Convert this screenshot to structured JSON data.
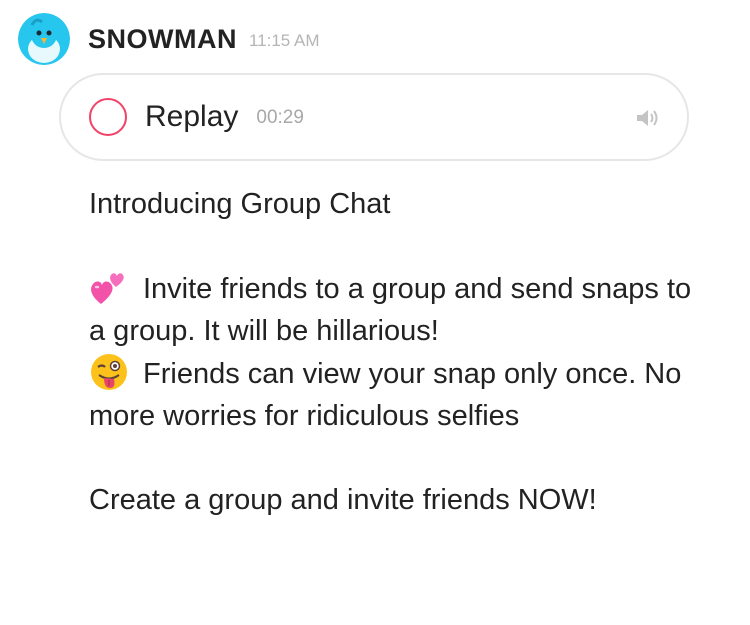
{
  "message": {
    "sender": "SNOWMAN",
    "time": "11:15 AM",
    "avatar_icon": "bird-icon",
    "replay": {
      "label": "Replay",
      "duration": "00:29",
      "speaker_icon": "speaker-icon",
      "accent": "#f2426a"
    },
    "body": {
      "title": "Introducing Group Chat",
      "para1_icon": "two-hearts-emoji",
      "para1_text": "Invite friends to a group and send snaps to a group. It will be hillarious!",
      "para2_icon": "winking-tongue-emoji",
      "para2_text": "Friends can view your snap only once. No more worries for ridiculous selfies",
      "cta": "Create a group and invite friends NOW!"
    }
  }
}
